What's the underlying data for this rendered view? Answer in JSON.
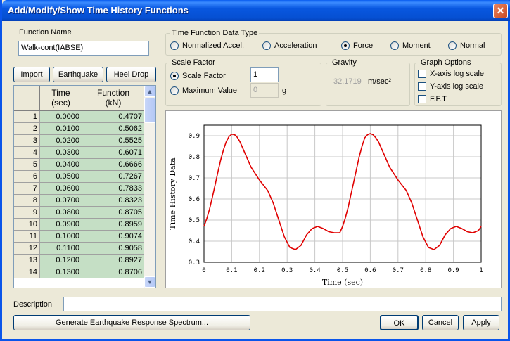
{
  "window": {
    "title": "Add/Modify/Show Time History Functions",
    "close_glyph": "✕"
  },
  "function_name": {
    "label": "Function Name",
    "value": "Walk-cont(IABSE)"
  },
  "data_type": {
    "label": "Time Function Data Type",
    "options": [
      "Normalized Accel.",
      "Acceleration",
      "Force",
      "Moment",
      "Normal"
    ],
    "selected": "Force"
  },
  "buttons": {
    "import": "Import",
    "earthquake": "Earthquake",
    "heel_drop": "Heel Drop"
  },
  "scale": {
    "label": "Scale Factor",
    "scale_factor_label": "Scale Factor",
    "scale_factor_value": "1",
    "max_value_label": "Maximum Value",
    "max_value_value": "0",
    "max_value_unit": "g",
    "selected": "Scale Factor"
  },
  "gravity": {
    "label": "Gravity",
    "value": "32.1719",
    "unit": "m/sec²"
  },
  "graph_options": {
    "label": "Graph Options",
    "x_log": "X-axis log scale",
    "y_log": "Y-axis log scale",
    "fft": "F.F.T"
  },
  "grid": {
    "col_time": [
      "Time",
      "(sec)"
    ],
    "col_func": [
      "Function",
      "(kN)"
    ],
    "rows": [
      [
        "1",
        "0.0000",
        "0.4707"
      ],
      [
        "2",
        "0.0100",
        "0.5062"
      ],
      [
        "3",
        "0.0200",
        "0.5525"
      ],
      [
        "4",
        "0.0300",
        "0.6071"
      ],
      [
        "5",
        "0.0400",
        "0.6666"
      ],
      [
        "6",
        "0.0500",
        "0.7267"
      ],
      [
        "7",
        "0.0600",
        "0.7833"
      ],
      [
        "8",
        "0.0700",
        "0.8323"
      ],
      [
        "9",
        "0.0800",
        "0.8705"
      ],
      [
        "10",
        "0.0900",
        "0.8959"
      ],
      [
        "11",
        "0.1000",
        "0.9074"
      ],
      [
        "12",
        "0.1100",
        "0.9058"
      ],
      [
        "13",
        "0.1200",
        "0.8927"
      ],
      [
        "14",
        "0.1300",
        "0.8706"
      ]
    ]
  },
  "chart_data": {
    "type": "line",
    "xlabel": "Time (sec)",
    "ylabel": "Time History Data",
    "xlim": [
      0,
      1
    ],
    "ylim": [
      0.3,
      0.95
    ],
    "xticks": [
      "0",
      "0.1",
      "0.2",
      "0.3",
      "0.4",
      "0.5",
      "0.6",
      "0.7",
      "0.8",
      "0.9",
      "1"
    ],
    "yticks": [
      "0.3",
      "0.4",
      "0.5",
      "0.6",
      "0.7",
      "0.8",
      "0.9"
    ],
    "grid": true,
    "line_color": "#E00000",
    "x": [
      0,
      0.01,
      0.02,
      0.03,
      0.04,
      0.05,
      0.06,
      0.07,
      0.08,
      0.09,
      0.1,
      0.11,
      0.12,
      0.13,
      0.15,
      0.17,
      0.2,
      0.23,
      0.25,
      0.27,
      0.29,
      0.31,
      0.33,
      0.35,
      0.37,
      0.39,
      0.41,
      0.43,
      0.45,
      0.47,
      0.49,
      0.5,
      0.51,
      0.52,
      0.53,
      0.54,
      0.55,
      0.56,
      0.57,
      0.58,
      0.59,
      0.6,
      0.61,
      0.62,
      0.63,
      0.65,
      0.67,
      0.7,
      0.73,
      0.75,
      0.77,
      0.79,
      0.81,
      0.83,
      0.85,
      0.87,
      0.89,
      0.91,
      0.93,
      0.95,
      0.97,
      0.99,
      1.0
    ],
    "y": [
      0.4707,
      0.5062,
      0.5525,
      0.6071,
      0.6666,
      0.7267,
      0.7833,
      0.8323,
      0.8705,
      0.8959,
      0.9074,
      0.9058,
      0.8927,
      0.8706,
      0.81,
      0.75,
      0.69,
      0.64,
      0.58,
      0.5,
      0.42,
      0.37,
      0.36,
      0.38,
      0.43,
      0.46,
      0.47,
      0.46,
      0.445,
      0.44,
      0.44,
      0.47,
      0.51,
      0.56,
      0.62,
      0.68,
      0.74,
      0.8,
      0.85,
      0.89,
      0.905,
      0.91,
      0.905,
      0.89,
      0.87,
      0.81,
      0.75,
      0.69,
      0.64,
      0.58,
      0.5,
      0.42,
      0.37,
      0.36,
      0.38,
      0.43,
      0.46,
      0.47,
      0.46,
      0.445,
      0.44,
      0.45,
      0.47
    ]
  },
  "description": {
    "label": "Description",
    "value": ""
  },
  "footer": {
    "generate": "Generate Earthquake Response Spectrum...",
    "ok": "OK",
    "cancel": "Cancel",
    "apply": "Apply"
  }
}
